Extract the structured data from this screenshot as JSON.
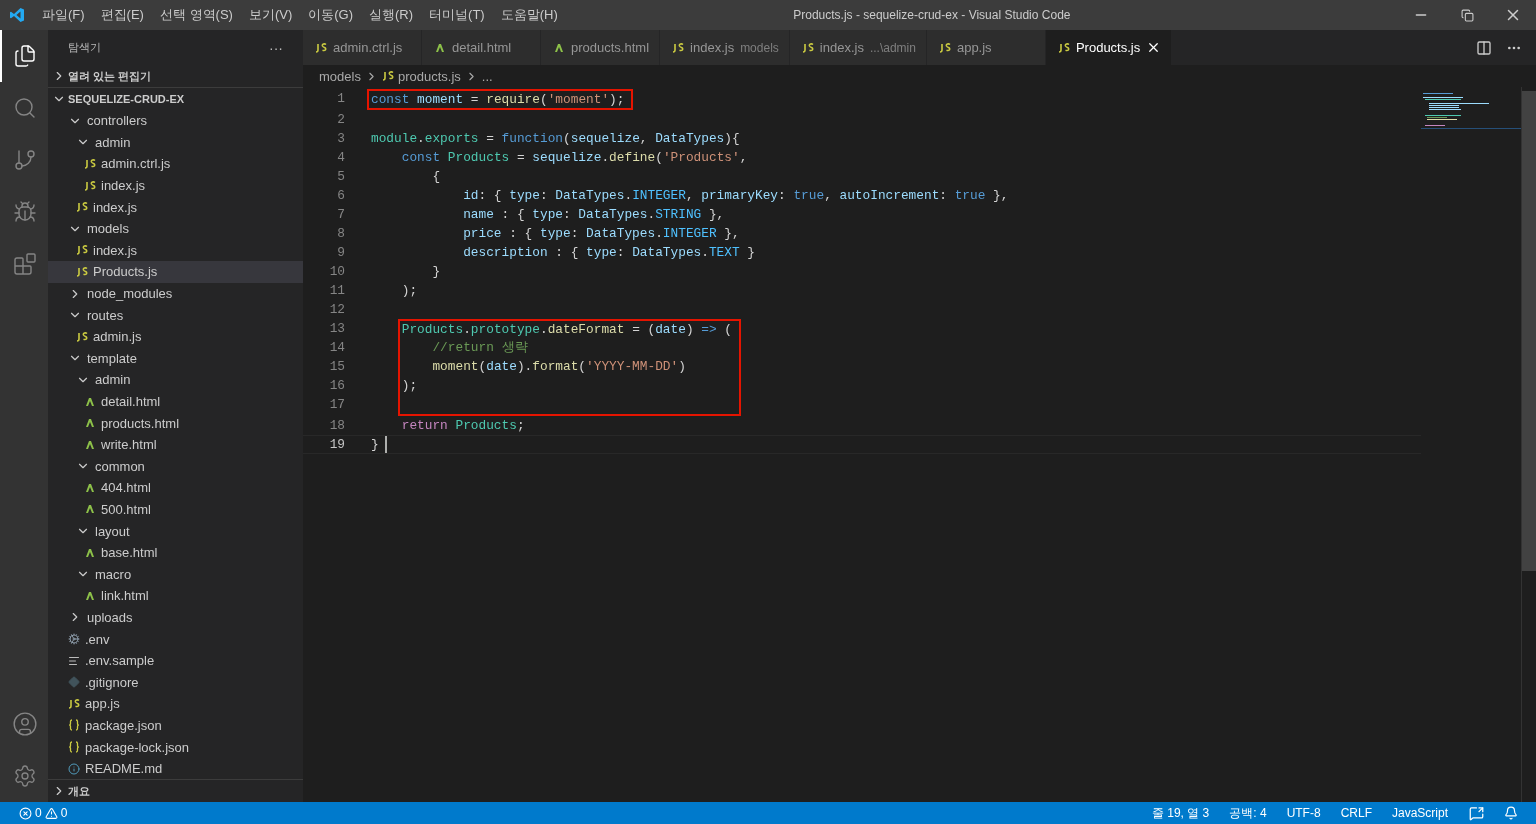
{
  "menu": [
    "파일(F)",
    "편집(E)",
    "선택 영역(S)",
    "보기(V)",
    "이동(G)",
    "실행(R)",
    "터미널(T)",
    "도움말(H)"
  ],
  "window": {
    "title": "Products.js - sequelize-crud-ex - Visual Studio Code"
  },
  "activity_bar": [
    {
      "kind": "files",
      "selected": true
    },
    {
      "kind": "search",
      "selected": false
    },
    {
      "kind": "branch",
      "selected": false
    },
    {
      "kind": "debug",
      "selected": false
    },
    {
      "kind": "extensions",
      "selected": false
    }
  ],
  "sidebar": {
    "title": "탐색기",
    "more": "···",
    "open_editors": {
      "label": "열려 있는 편집기",
      "expanded": false
    },
    "project": {
      "label": "SEQUELIZE-CRUD-EX",
      "expanded": true
    },
    "items": [
      {
        "label": "controllers",
        "kind": "folder",
        "expanded": true,
        "selected": false,
        "children": [
          {
            "label": "admin",
            "kind": "folder",
            "expanded": true,
            "selected": false,
            "children": [
              {
                "label": "admin.ctrl.js",
                "kind": "js",
                "selected": false
              },
              {
                "label": "index.js",
                "kind": "js",
                "selected": false
              }
            ]
          },
          {
            "label": "index.js",
            "kind": "js",
            "selected": false
          }
        ]
      },
      {
        "label": "models",
        "kind": "folder",
        "expanded": true,
        "selected": false,
        "children": [
          {
            "label": "index.js",
            "kind": "js",
            "selected": false
          },
          {
            "label": "Products.js",
            "kind": "js",
            "selected": true
          }
        ]
      },
      {
        "label": "node_modules",
        "kind": "folder",
        "expanded": false,
        "selected": false
      },
      {
        "label": "routes",
        "kind": "folder",
        "expanded": true,
        "selected": false,
        "children": [
          {
            "label": "admin.js",
            "kind": "js",
            "selected": false
          }
        ]
      },
      {
        "label": "template",
        "kind": "folder",
        "expanded": true,
        "selected": false,
        "children": [
          {
            "label": "admin",
            "kind": "folder",
            "expanded": true,
            "selected": false,
            "children": [
              {
                "label": "detail.html",
                "kind": "html",
                "selected": false
              },
              {
                "label": "products.html",
                "kind": "html",
                "selected": false
              },
              {
                "label": "write.html",
                "kind": "html",
                "selected": false
              }
            ]
          },
          {
            "label": "common",
            "kind": "folder",
            "expanded": true,
            "selected": false,
            "children": [
              {
                "label": "404.html",
                "kind": "html",
                "selected": false
              },
              {
                "label": "500.html",
                "kind": "html",
                "selected": false
              }
            ]
          },
          {
            "label": "layout",
            "kind": "folder",
            "expanded": true,
            "selected": false,
            "children": [
              {
                "label": "base.html",
                "kind": "html",
                "selected": false
              }
            ]
          },
          {
            "label": "macro",
            "kind": "folder",
            "expanded": true,
            "selected": false,
            "children": [
              {
                "label": "link.html",
                "kind": "html",
                "selected": false
              }
            ]
          }
        ]
      },
      {
        "label": "uploads",
        "kind": "folder",
        "expanded": false,
        "selected": false
      },
      {
        "label": ".env",
        "kind": "settings",
        "selected": false
      },
      {
        "label": ".env.sample",
        "kind": "text",
        "selected": false
      },
      {
        "label": ".gitignore",
        "kind": "git",
        "selected": false
      },
      {
        "label": "app.js",
        "kind": "js",
        "selected": false
      },
      {
        "label": "package.json",
        "kind": "json",
        "selected": false
      },
      {
        "label": "package-lock.json",
        "kind": "json",
        "selected": false
      },
      {
        "label": "README.md",
        "kind": "info",
        "selected": false
      }
    ],
    "outline": {
      "label": "개요",
      "expanded": false
    }
  },
  "tabs": [
    {
      "label": "admin.ctrl.js",
      "kind": "js",
      "selected": false
    },
    {
      "label": "detail.html",
      "kind": "html",
      "selected": false
    },
    {
      "label": "products.html",
      "kind": "html",
      "selected": false
    },
    {
      "label": "index.js",
      "description": "models",
      "kind": "js",
      "selected": false
    },
    {
      "label": "index.js",
      "description": "...\\admin",
      "kind": "js",
      "selected": false
    },
    {
      "label": "app.js",
      "kind": "js",
      "selected": false
    },
    {
      "label": "Products.js",
      "kind": "js",
      "selected": true
    }
  ],
  "breadcrumbs": [
    {
      "label": "models",
      "kind": "folder"
    },
    {
      "label": "products.js",
      "kind": "js"
    },
    {
      "label": "...",
      "kind": "more"
    }
  ],
  "code": [
    {
      "number": "1",
      "highlighted": true,
      "tokens": [
        {
          "text": "const",
          "kind": "keyword"
        },
        {
          "text": " moment",
          "kind": "var"
        },
        {
          "text": " = ",
          "kind": "plain"
        },
        {
          "text": "require",
          "kind": "func"
        },
        {
          "text": "(",
          "kind": "plain"
        },
        {
          "text": "'moment'",
          "kind": "string"
        },
        {
          "text": ");",
          "kind": "plain"
        }
      ]
    },
    {
      "number": "2",
      "highlighted": false
    },
    {
      "number": "3",
      "highlighted": false,
      "tokens": [
        {
          "text": "module",
          "kind": "class"
        },
        {
          "text": ".",
          "kind": "plain"
        },
        {
          "text": "exports",
          "kind": "class"
        },
        {
          "text": " = ",
          "kind": "plain"
        },
        {
          "text": "function",
          "kind": "keyword"
        },
        {
          "text": "(",
          "kind": "plain"
        },
        {
          "text": "sequelize",
          "kind": "var"
        },
        {
          "text": ", ",
          "kind": "plain"
        },
        {
          "text": "DataTypes",
          "kind": "var"
        },
        {
          "text": "){",
          "kind": "plain"
        }
      ]
    },
    {
      "number": "4",
      "highlighted": false,
      "tokens": [
        {
          "text": "    const",
          "kind": "keyword"
        },
        {
          "text": " Products",
          "kind": "class"
        },
        {
          "text": " = ",
          "kind": "plain"
        },
        {
          "text": "sequelize",
          "kind": "var"
        },
        {
          "text": ".",
          "kind": "plain"
        },
        {
          "text": "define",
          "kind": "func"
        },
        {
          "text": "(",
          "kind": "plain"
        },
        {
          "text": "'Products'",
          "kind": "string"
        },
        {
          "text": ",",
          "kind": "plain"
        }
      ]
    },
    {
      "number": "5",
      "highlighted": false,
      "tokens": [
        {
          "text": "        {",
          "kind": "plain"
        }
      ]
    },
    {
      "number": "6",
      "highlighted": false,
      "tokens": [
        {
          "text": "            id",
          "kind": "var"
        },
        {
          "text": ": { ",
          "kind": "plain"
        },
        {
          "text": "type",
          "kind": "var"
        },
        {
          "text": ": ",
          "kind": "plain"
        },
        {
          "text": "DataTypes",
          "kind": "var"
        },
        {
          "text": ".",
          "kind": "plain"
        },
        {
          "text": "INTEGER",
          "kind": "const"
        },
        {
          "text": ", ",
          "kind": "plain"
        },
        {
          "text": "primaryKey",
          "kind": "var"
        },
        {
          "text": ": ",
          "kind": "plain"
        },
        {
          "text": "true",
          "kind": "keyword"
        },
        {
          "text": ", ",
          "kind": "plain"
        },
        {
          "text": "autoIncrement",
          "kind": "var"
        },
        {
          "text": ": ",
          "kind": "plain"
        },
        {
          "text": "true",
          "kind": "keyword"
        },
        {
          "text": " },",
          "kind": "plain"
        }
      ]
    },
    {
      "number": "7",
      "highlighted": false,
      "tokens": [
        {
          "text": "            name",
          "kind": "var"
        },
        {
          "text": " : { ",
          "kind": "plain"
        },
        {
          "text": "type",
          "kind": "var"
        },
        {
          "text": ": ",
          "kind": "plain"
        },
        {
          "text": "DataTypes",
          "kind": "var"
        },
        {
          "text": ".",
          "kind": "plain"
        },
        {
          "text": "STRING",
          "kind": "const"
        },
        {
          "text": " },",
          "kind": "plain"
        }
      ]
    },
    {
      "number": "8",
      "highlighted": false,
      "tokens": [
        {
          "text": "            price",
          "kind": "var"
        },
        {
          "text": " : { ",
          "kind": "plain"
        },
        {
          "text": "type",
          "kind": "var"
        },
        {
          "text": ": ",
          "kind": "plain"
        },
        {
          "text": "DataTypes",
          "kind": "var"
        },
        {
          "text": ".",
          "kind": "plain"
        },
        {
          "text": "INTEGER",
          "kind": "const"
        },
        {
          "text": " },",
          "kind": "plain"
        }
      ]
    },
    {
      "number": "9",
      "highlighted": false,
      "tokens": [
        {
          "text": "            description",
          "kind": "var"
        },
        {
          "text": " : { ",
          "kind": "plain"
        },
        {
          "text": "type",
          "kind": "var"
        },
        {
          "text": ": ",
          "kind": "plain"
        },
        {
          "text": "DataTypes",
          "kind": "var"
        },
        {
          "text": ".",
          "kind": "plain"
        },
        {
          "text": "TEXT",
          "kind": "const"
        },
        {
          "text": " }",
          "kind": "plain"
        }
      ]
    },
    {
      "number": "10",
      "highlighted": false,
      "tokens": [
        {
          "text": "        }",
          "kind": "plain"
        }
      ]
    },
    {
      "number": "11",
      "highlighted": false,
      "tokens": [
        {
          "text": "    );",
          "kind": "plain"
        }
      ]
    },
    {
      "number": "12",
      "highlighted": false
    },
    {
      "number": "13",
      "highlighted": true,
      "tokens": [
        {
          "text": "    Products",
          "kind": "class"
        },
        {
          "text": ".",
          "kind": "plain"
        },
        {
          "text": "prototype",
          "kind": "class"
        },
        {
          "text": ".",
          "kind": "plain"
        },
        {
          "text": "dateFormat",
          "kind": "func"
        },
        {
          "text": " = (",
          "kind": "plain"
        },
        {
          "text": "date",
          "kind": "var"
        },
        {
          "text": ") ",
          "kind": "plain"
        },
        {
          "text": "=>",
          "kind": "keyword"
        },
        {
          "text": " (",
          "kind": "plain"
        }
      ]
    },
    {
      "number": "14",
      "highlighted": true,
      "tokens": [
        {
          "text": "        //return 생략",
          "kind": "comment"
        }
      ]
    },
    {
      "number": "15",
      "highlighted": true,
      "tokens": [
        {
          "text": "        moment",
          "kind": "func"
        },
        {
          "text": "(",
          "kind": "plain"
        },
        {
          "text": "date",
          "kind": "var"
        },
        {
          "text": ").",
          "kind": "plain"
        },
        {
          "text": "format",
          "kind": "func"
        },
        {
          "text": "(",
          "kind": "plain"
        },
        {
          "text": "'YYYY-MM-DD'",
          "kind": "string"
        },
        {
          "text": ")",
          "kind": "plain"
        }
      ]
    },
    {
      "number": "16",
      "highlighted": true,
      "tokens": [
        {
          "text": "    );",
          "kind": "plain"
        }
      ]
    },
    {
      "number": "17",
      "highlighted": true
    },
    {
      "number": "18",
      "highlighted": false,
      "tokens": [
        {
          "text": "    return",
          "kind": "control"
        },
        {
          "text": " Products",
          "kind": "class"
        },
        {
          "text": ";",
          "kind": "plain"
        }
      ]
    },
    {
      "number": "19",
      "highlighted": false,
      "current": true,
      "tokens": [
        {
          "text": "}",
          "kind": "plain"
        }
      ]
    }
  ],
  "status_bar": {
    "errors": "0",
    "warnings": "0",
    "items": [
      "줄 19, 열 3",
      "공백: 4",
      "UTF-8",
      "CRLF",
      "JavaScript"
    ]
  }
}
